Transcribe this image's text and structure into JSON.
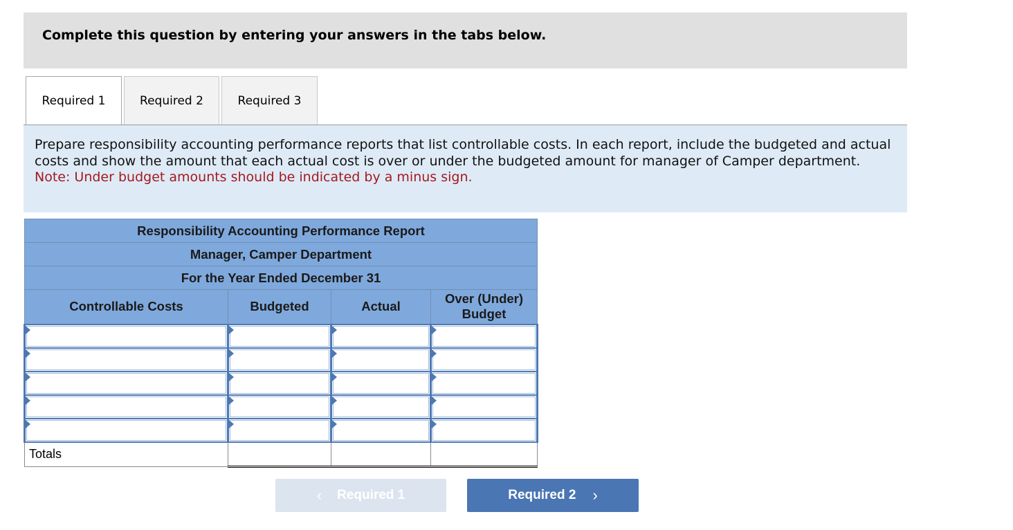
{
  "header": {
    "title": "Complete this question by entering your answers in the tabs below."
  },
  "tabs": [
    {
      "label": "Required 1",
      "active": true
    },
    {
      "label": "Required 2",
      "active": false
    },
    {
      "label": "Required 3",
      "active": false
    }
  ],
  "instructions": {
    "text": "Prepare responsibility accounting performance reports that list controllable costs. In each report, include the budgeted and actual costs and show the amount that each actual cost is over or under the budgeted amount for manager of Camper department.",
    "note": "Note: Under budget amounts should be indicated by a minus sign.",
    "note_color": "#a5191d"
  },
  "report": {
    "title_lines": [
      "Responsibility Accounting Performance Report",
      "Manager, Camper Department",
      "For the Year Ended December 31"
    ],
    "columns": [
      "Controllable Costs",
      "Budgeted",
      "Actual",
      "Over (Under)\nBudget"
    ],
    "column_over_line1": "Over (Under)",
    "column_over_line2": "Budget",
    "rows": [
      {
        "controllable_cost": "",
        "budgeted": "",
        "actual": "",
        "over_under": ""
      },
      {
        "controllable_cost": "",
        "budgeted": "",
        "actual": "",
        "over_under": ""
      },
      {
        "controllable_cost": "",
        "budgeted": "",
        "actual": "",
        "over_under": ""
      },
      {
        "controllable_cost": "",
        "budgeted": "",
        "actual": "",
        "over_under": ""
      },
      {
        "controllable_cost": "",
        "budgeted": "",
        "actual": "",
        "over_under": ""
      }
    ],
    "totals": {
      "label": "Totals",
      "budgeted": "",
      "actual": "",
      "over_under": ""
    },
    "header_color": "#7fa9dc",
    "input_border_color": "#4e78b2"
  },
  "navigation": {
    "prev_label": "Required 1",
    "prev_icon": "chevron-left-icon",
    "prev_enabled": false,
    "next_label": "Required 2",
    "next_icon": "chevron-right-icon",
    "next_enabled": true,
    "next_color": "#4a76b4"
  }
}
